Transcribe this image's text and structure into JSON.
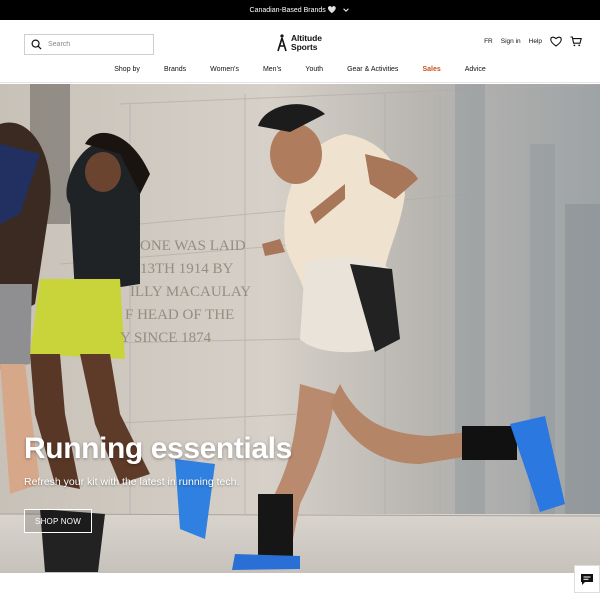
{
  "announcement": {
    "text": "Canadian-Based Brands 🤍"
  },
  "search": {
    "placeholder": "Search"
  },
  "logo": {
    "line1": "Altitude",
    "line2": "Sports"
  },
  "utility": {
    "language": "FR",
    "sign_in": "Sign in",
    "help": "Help"
  },
  "nav": {
    "items": [
      "Shop by",
      "Brands",
      "Women's",
      "Men's",
      "Youth",
      "Gear & Activities",
      "Sales",
      "Advice"
    ]
  },
  "hero": {
    "title": "Running essentials",
    "subtitle": "Refresh your kit with the latest in running tech.",
    "cta": "SHOP NOW",
    "inscription": [
      "ONE WAS LAID",
      "13TH 1914 BY",
      "ILLY MACAULAY",
      "F HEAD OF THE",
      "Y SINCE 1874"
    ]
  },
  "colors": {
    "sale": "#c8501e",
    "announcement_bg": "#000000"
  }
}
